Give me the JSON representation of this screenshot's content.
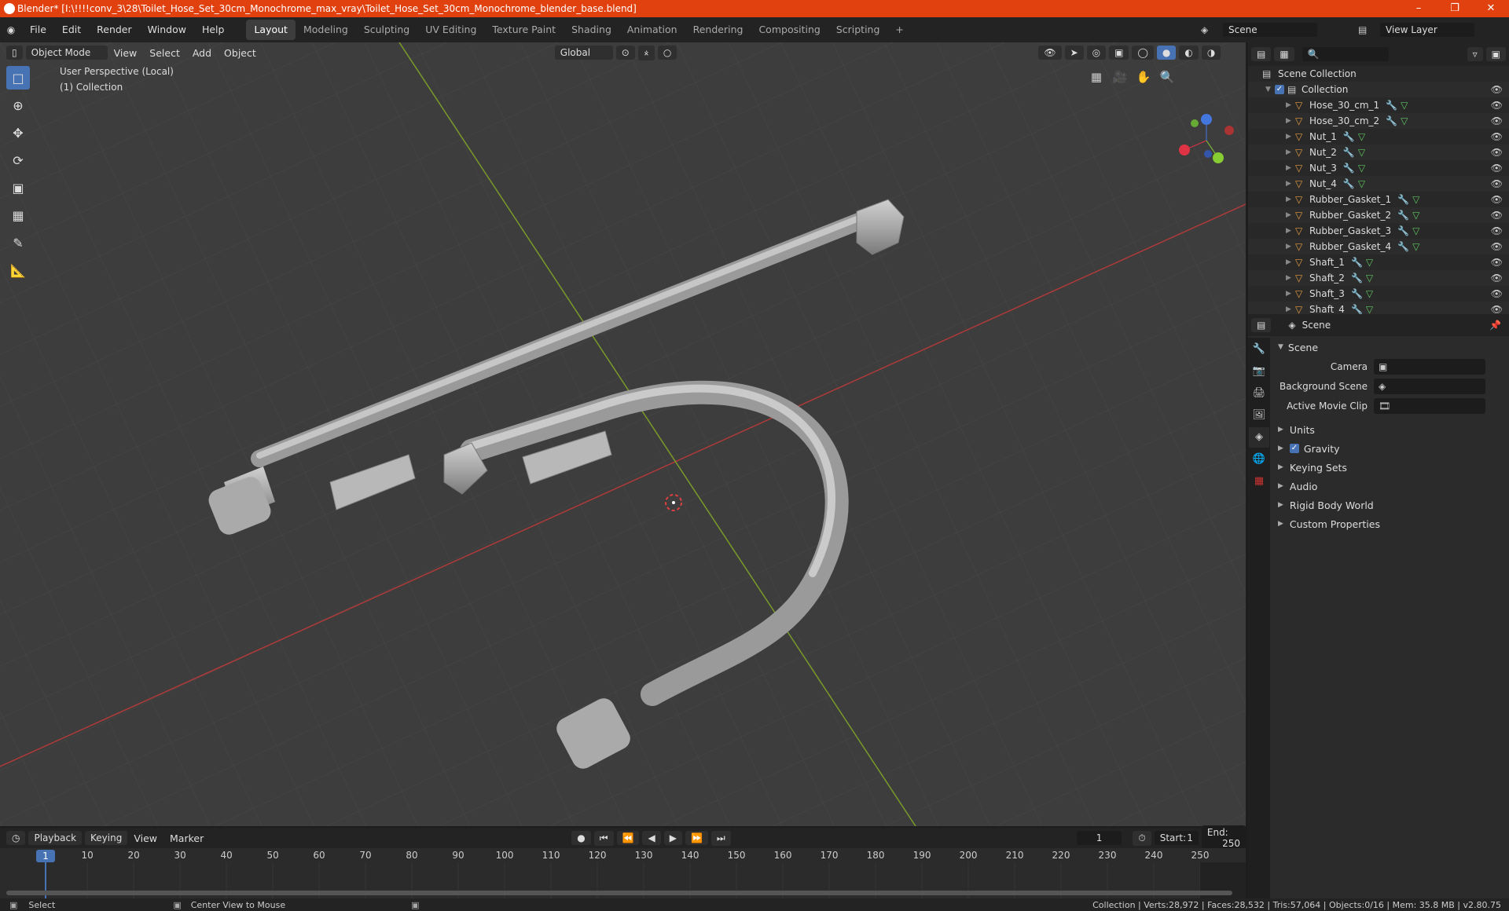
{
  "titlebar": {
    "title": "Blender* [I:\\!!!!conv_3\\28\\Toilet_Hose_Set_30cm_Monochrome_max_vray\\Toilet_Hose_Set_30cm_Monochrome_blender_base.blend]"
  },
  "menus": [
    "File",
    "Edit",
    "Render",
    "Window",
    "Help"
  ],
  "workspaces": [
    "Layout",
    "Modeling",
    "Sculpting",
    "UV Editing",
    "Texture Paint",
    "Shading",
    "Animation",
    "Rendering",
    "Compositing",
    "Scripting"
  ],
  "active_workspace": "Layout",
  "scene_field": "Scene",
  "view_layer_field": "View Layer",
  "viewport": {
    "mode": "Object Mode",
    "menus": [
      "View",
      "Select",
      "Add",
      "Object"
    ],
    "orientation": "Global",
    "overlay_text": "User Perspective (Local)",
    "collection_text": "(1) Collection"
  },
  "outliner": {
    "root": "Scene Collection",
    "collection": "Collection",
    "objects": [
      "Hose_30_cm_1",
      "Hose_30_cm_2",
      "Nut_1",
      "Nut_2",
      "Nut_3",
      "Nut_4",
      "Rubber_Gasket_1",
      "Rubber_Gasket_2",
      "Rubber_Gasket_3",
      "Rubber_Gasket_4",
      "Shaft_1",
      "Shaft_2",
      "Shaft_3",
      "Shaft_4"
    ]
  },
  "properties": {
    "header": "Scene",
    "section": "Scene",
    "fields": [
      {
        "label": "Camera",
        "value": ""
      },
      {
        "label": "Background Scene",
        "value": ""
      },
      {
        "label": "Active Movie Clip",
        "value": ""
      }
    ],
    "panels": [
      "Units",
      "Gravity",
      "Keying Sets",
      "Audio",
      "Rigid Body World",
      "Custom Properties"
    ]
  },
  "timeline": {
    "menus": [
      "Playback",
      "Keying",
      "View",
      "Marker"
    ],
    "current_frame": "1",
    "start_label": "Start:",
    "start": "1",
    "end_label": "End:",
    "end": "250",
    "ticks": [
      "1",
      "10",
      "20",
      "30",
      "40",
      "50",
      "60",
      "70",
      "80",
      "90",
      "100",
      "110",
      "120",
      "130",
      "140",
      "150",
      "160",
      "170",
      "180",
      "190",
      "200",
      "210",
      "220",
      "230",
      "240",
      "250"
    ]
  },
  "statusbar": {
    "left1": "Select",
    "left2": "Center View to Mouse",
    "right": "Collection | Verts:28,972 | Faces:28,532 | Tris:57,064 | Objects:0/16 | Mem: 35.8 MB | v2.80.75"
  }
}
